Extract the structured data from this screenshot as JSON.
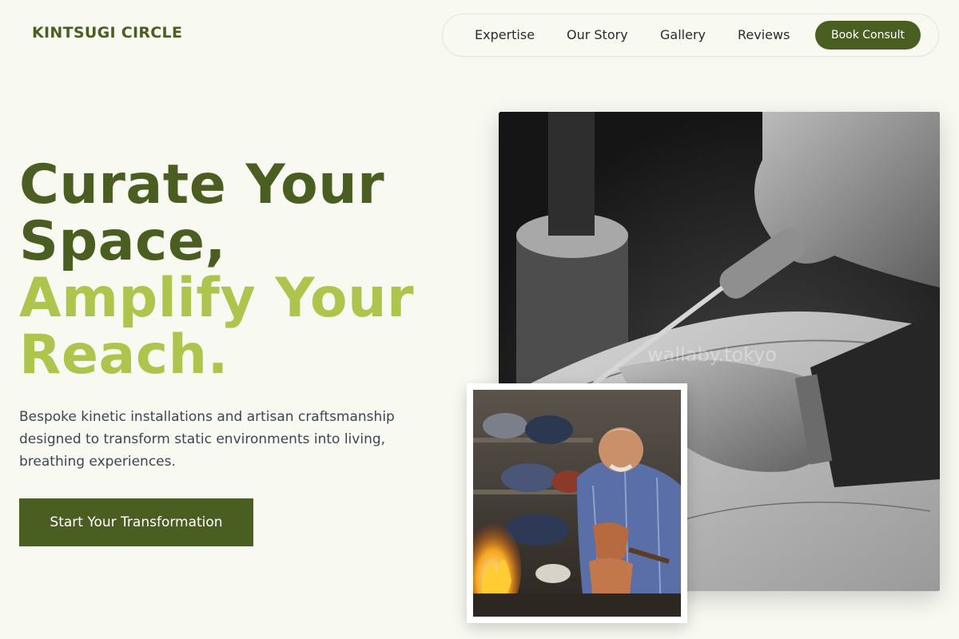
{
  "brand": {
    "name": "KINTSUGI CIRCLE"
  },
  "nav": {
    "links": [
      "Expertise",
      "Our Story",
      "Gallery",
      "Reviews"
    ],
    "cta_label": "Book Consult"
  },
  "hero": {
    "headline_line1": "Curate Your",
    "headline_line2": "Space,",
    "headline_line3": "Amplify Your",
    "headline_line4": "Reach.",
    "subtext": "Bespoke kinetic installations and artisan craftsmanship designed to transform static environments into living, breathing experiences.",
    "button_label": "Start Your Transformation"
  },
  "images": {
    "primary_alt": "Black and white photo of hands carving wood with a chisel",
    "secondary_alt": "Craftsman working copper pots over a fire",
    "watermark": "wallaby.tokyo"
  },
  "colors": {
    "background": "#f8f9f1",
    "brand_dark": "#4b5e22",
    "accent_lime": "#adc44d",
    "body_text": "#3d4550"
  },
  "icons": []
}
